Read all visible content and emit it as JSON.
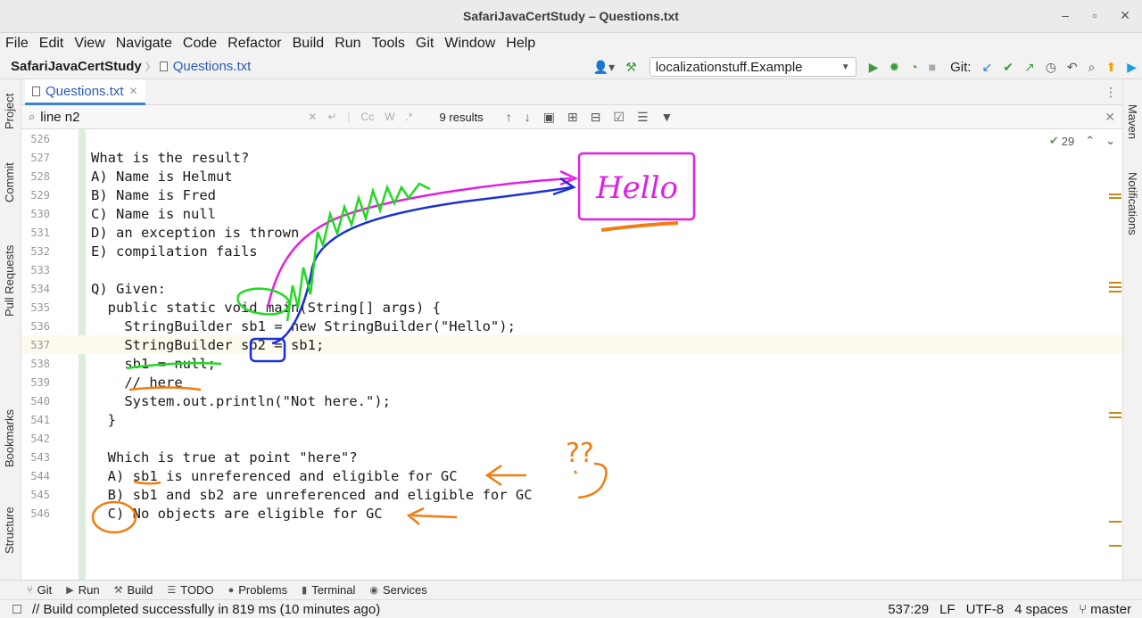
{
  "window": {
    "title": "SafariJavaCertStudy – Questions.txt",
    "minimize": "–",
    "restore": "▫",
    "close": "✕"
  },
  "menu": [
    "File",
    "Edit",
    "View",
    "Navigate",
    "Code",
    "Refactor",
    "Build",
    "Run",
    "Tools",
    "Git",
    "Window",
    "Help"
  ],
  "nav": {
    "project": "SafariJavaCertStudy",
    "file": "Questions.txt",
    "run_config": "localizationstuff.Example",
    "git_label": "Git:"
  },
  "left_tabs": [
    "Project",
    "Commit",
    "Pull Requests",
    "Bookmarks",
    "Structure"
  ],
  "right_tabs": [
    "Maven",
    "Notifications"
  ],
  "editor_tab": {
    "label": "Questions.txt"
  },
  "search": {
    "value": "line n2",
    "results": "9 results",
    "cc": "Cc",
    "w": "W",
    "regex": ".*"
  },
  "inspections": {
    "count": "29"
  },
  "lines": [
    {
      "num": "526",
      "text": ""
    },
    {
      "num": "527",
      "text": "What is the result?"
    },
    {
      "num": "528",
      "text": "A) Name is Helmut"
    },
    {
      "num": "529",
      "text": "B) Name is Fred"
    },
    {
      "num": "530",
      "text": "C) Name is null"
    },
    {
      "num": "531",
      "text": "D) an exception is thrown"
    },
    {
      "num": "532",
      "text": "E) compilation fails"
    },
    {
      "num": "533",
      "text": ""
    },
    {
      "num": "534",
      "text": "Q) Given:"
    },
    {
      "num": "535",
      "text": "  public static void main(String[] args) {"
    },
    {
      "num": "536",
      "text": "    StringBuilder sb1 = new StringBuilder(\"Hello\");"
    },
    {
      "num": "537",
      "text": "    StringBuilder sb2 = sb1;"
    },
    {
      "num": "538",
      "text": "    sb1 = null;"
    },
    {
      "num": "539",
      "text": "    // here"
    },
    {
      "num": "540",
      "text": "    System.out.println(\"Not here.\");"
    },
    {
      "num": "541",
      "text": "  }"
    },
    {
      "num": "542",
      "text": ""
    },
    {
      "num": "543",
      "text": "  Which is true at point \"here\"?"
    },
    {
      "num": "544",
      "text": "  A) sb1 is unreferenced and eligible for GC"
    },
    {
      "num": "545",
      "text": "  B) sb1 and sb2 are unreferenced and eligible for GC"
    },
    {
      "num": "546",
      "text": "  C) No objects are eligible for GC"
    }
  ],
  "annotation": {
    "hello_text": "Hello",
    "question_marks": "??"
  },
  "tool_windows": [
    {
      "icon": "git-icon",
      "label": "Git"
    },
    {
      "icon": "run-icon",
      "label": "Run"
    },
    {
      "icon": "build-icon",
      "label": "Build"
    },
    {
      "icon": "todo-icon",
      "label": "TODO"
    },
    {
      "icon": "problems-icon",
      "label": "Problems"
    },
    {
      "icon": "terminal-icon",
      "label": "Terminal"
    },
    {
      "icon": "services-icon",
      "label": "Services"
    }
  ],
  "status": {
    "message": "// Build completed successfully in 819 ms (10 minutes ago)",
    "position": "537:29",
    "line_sep": "LF",
    "encoding": "UTF-8",
    "indent": "4 spaces",
    "branch": "master"
  },
  "colors": {
    "accent": "#4083c9",
    "annotation_magenta": "#e020e0",
    "annotation_blue": "#1a2fd6",
    "annotation_green": "#22d822",
    "annotation_orange": "#f07d10"
  }
}
